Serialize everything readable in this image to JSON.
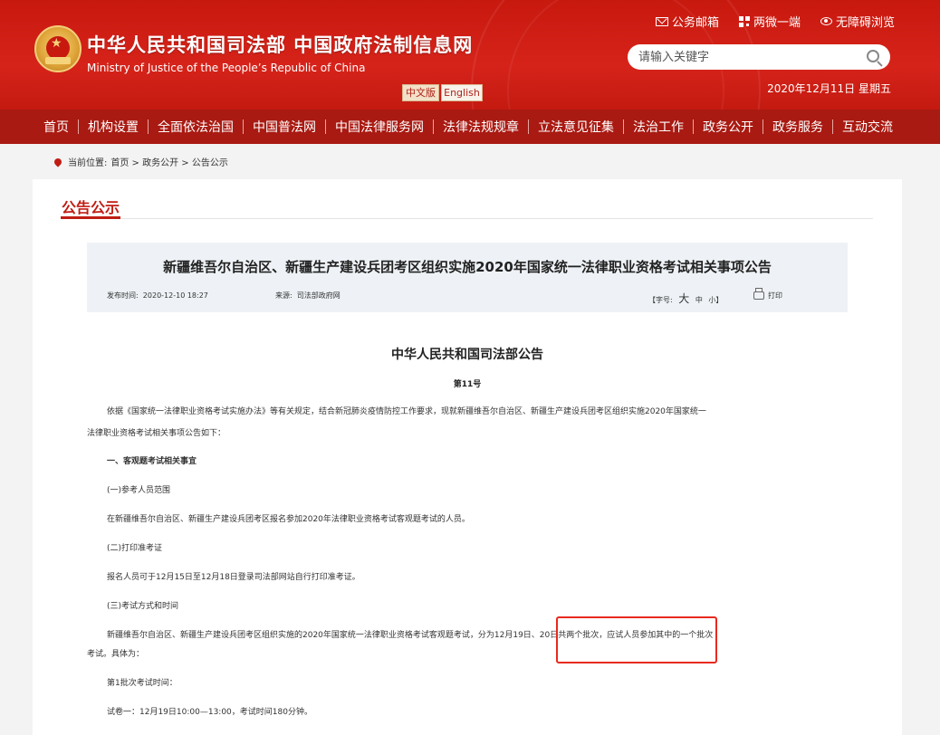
{
  "header": {
    "site_title": "中华人民共和国司法部  中国政府法制信息网",
    "site_subtitle": "Ministry of Justice of the People’s Republic of China",
    "lang_cn": "中文版",
    "lang_en": "English",
    "top_links": [
      "公务邮箱",
      "两微一端",
      "无障碍浏览"
    ],
    "search_placeholder": "请输入关键字",
    "date": "2020年12月11日 星期五"
  },
  "nav": {
    "items": [
      "首页",
      "机构设置",
      "全面依法治国",
      "中国普法网",
      "中国法律服务网",
      "法律法规规章",
      "立法意见征集",
      "法治工作",
      "政务公开",
      "政务服务",
      "互动交流"
    ]
  },
  "breadcrumb": {
    "label": "当前位置:",
    "path": "首页 > 政务公开 > 公告公示"
  },
  "section": {
    "title": "公告公示"
  },
  "article": {
    "title": "新疆维吾尔自治区、新疆生产建设兵团考区组织实施2020年国家统一法律职业资格考试相关事项公告",
    "publish_label": "发布时间:",
    "publish_time": "2020-12-10 18:27",
    "source_label": "来源:",
    "source": "司法部政府网",
    "font_label": "【字号:",
    "font_big": "大",
    "font_mid": "中",
    "font_small": "小】",
    "print_label": "打印"
  },
  "doc": {
    "title": "中华人民共和国司法部公告",
    "number": "第11号",
    "paragraphs": [
      "依据《国家统一法律职业资格考试实施办法》等有关规定，结合新冠肺炎疫情防控工作要求，现就新疆维吾尔自治区、新疆生产建设兵团考区组织实施2020年国家统一",
      "法律职业资格考试相关事项公告如下：",
      "一、客观题考试相关事宜",
      "(一)参考人员范围",
      "在新疆维吾尔自治区、新疆生产建设兵团考区报名参加2020年法律职业资格考试客观题考试的人员。",
      "(二)打印准考证",
      "报名人员可于12月15日至12月18日登录司法部网站自行打印准考证。",
      "(三)考试方式和时间",
      "新疆维吾尔自治区、新疆生产建设兵团考区组织实施的2020年国家统一法律职业资格考试客观题考试，分为12月19日、20日共两个批次，应试人员参加其中的一个批次",
      "考试。具体为：",
      "第1批次考试时间：",
      "试卷一：12月19日10:00—13:00，考试时间180分钟。"
    ]
  },
  "colors": {
    "header_red": "#c8190f",
    "nav_red": "#a91a12",
    "accent": "#c01d14",
    "highlight_box": "#e82a1f"
  }
}
